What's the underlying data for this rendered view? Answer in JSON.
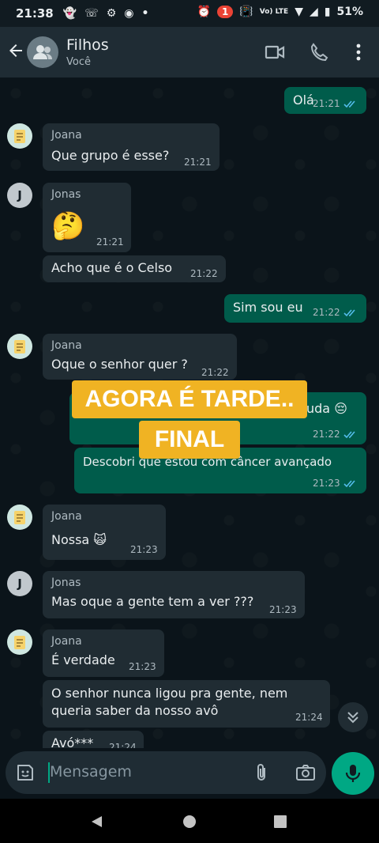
{
  "status_bar": {
    "time": "21:38",
    "notification_count": "1",
    "network": "Vo) LTE",
    "battery": "51%"
  },
  "header": {
    "title": "Filhos",
    "subtitle": "Você"
  },
  "messages": [
    {
      "dir": "out",
      "text": "Olá",
      "time": "21:21"
    },
    {
      "dir": "in",
      "sender": "Joana",
      "text": "Que grupo é esse?",
      "time": "21:21"
    },
    {
      "dir": "in",
      "sender": "Jonas",
      "text": "🤔",
      "time": "21:21"
    },
    {
      "dir": "in",
      "text": "Acho que é o Celso",
      "time": "21:22"
    },
    {
      "dir": "out",
      "text": "Sim sou eu",
      "time": "21:22"
    },
    {
      "dir": "in",
      "sender": "Joana",
      "text": "Oque o senhor quer ?",
      "time": "21:22"
    },
    {
      "dir": "out",
      "text": "uda 😔",
      "time": "21:22"
    },
    {
      "dir": "out",
      "text": "Descobri que estou com câncer avançado",
      "time": "21:23"
    },
    {
      "dir": "in",
      "sender": "Joana",
      "text": "Nossa 🙀",
      "time": "21:23"
    },
    {
      "dir": "in",
      "sender": "Jonas",
      "text": "Mas oque a gente tem a ver ???",
      "time": "21:23"
    },
    {
      "dir": "in",
      "sender": "Joana",
      "text": "É verdade",
      "time": "21:23"
    },
    {
      "dir": "in",
      "text_line1": "O senhor nunca ligou pra gente, nem",
      "text_line2": "queria saber da nosso avô",
      "time": "21:24"
    },
    {
      "dir": "in",
      "text": "Avó***",
      "time": "21:24"
    }
  ],
  "overlay": {
    "line1": "AGORA É TARDE..",
    "line2": "FINAL"
  },
  "input": {
    "placeholder": "Mensagem"
  },
  "colors": {
    "incoming": "#202c33",
    "outgoing": "#005c4b",
    "accent": "#00a884",
    "overlay": "#f0b323",
    "read_ticks": "#53bdeb"
  },
  "icons": [
    "back-arrow-icon",
    "group-avatar-icon",
    "video-call-icon",
    "phone-icon",
    "more-vert-icon",
    "sticker-icon",
    "attach-icon",
    "camera-icon",
    "mic-icon",
    "double-chevron-down-icon"
  ]
}
